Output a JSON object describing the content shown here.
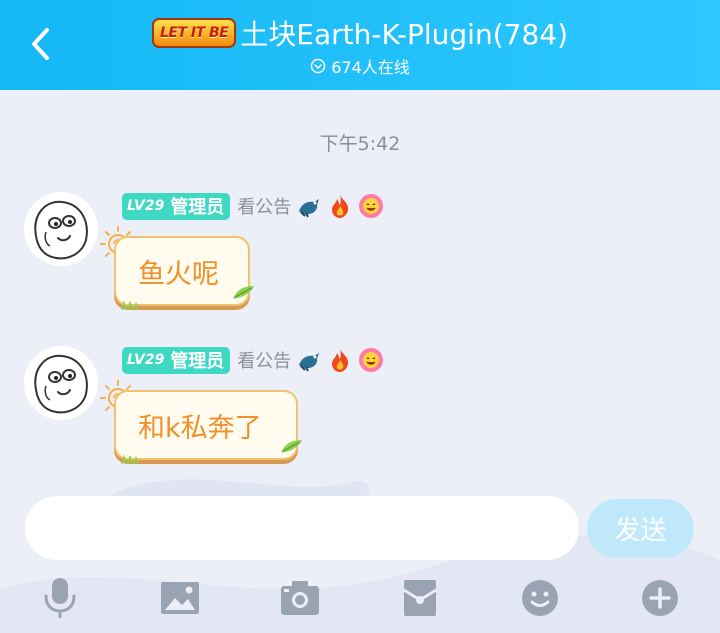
{
  "header": {
    "logo_text": "LET IT BE",
    "title": "土块Earth-K-Plugin(784)",
    "online_text": "674人在线"
  },
  "timestamp": "下午5:42",
  "messages": [
    {
      "level": "LV29",
      "role": "管理员",
      "notice": "看公告",
      "text": "鱼火呢"
    },
    {
      "level": "LV29",
      "role": "管理员",
      "notice": "看公告",
      "text": "和k私奔了"
    }
  ],
  "input": {
    "value": "",
    "placeholder": ""
  },
  "send_label": "发送",
  "toolbar": [
    "microphone-icon",
    "image-icon",
    "camera-icon",
    "red-packet-icon",
    "emoji-icon",
    "plus-icon"
  ],
  "colors": {
    "header": "#1ebdf7",
    "badge": "#3fd8c2",
    "bubble_text": "#f0902a",
    "send_button": "#bfe9fb",
    "toolbar_icon": "#9aa3b2"
  }
}
